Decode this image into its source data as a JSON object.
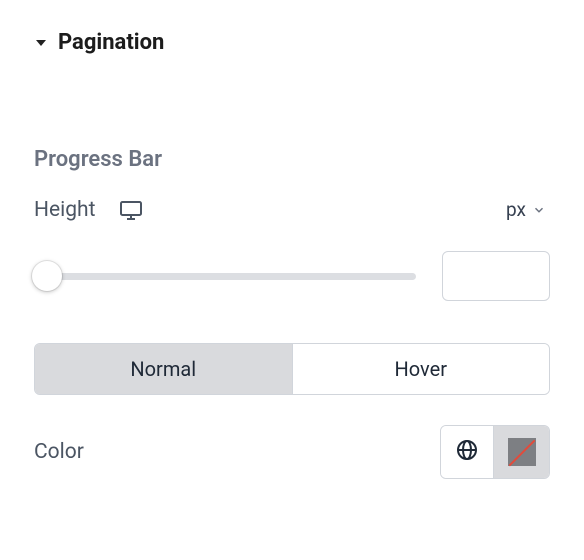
{
  "section": {
    "title": "Pagination"
  },
  "progress_bar": {
    "title": "Progress Bar",
    "height_label": "Height",
    "unit": "px",
    "value": "",
    "tabs": {
      "normal": "Normal",
      "hover": "Hover",
      "active": "normal"
    },
    "color_label": "Color",
    "color_value": "none"
  }
}
